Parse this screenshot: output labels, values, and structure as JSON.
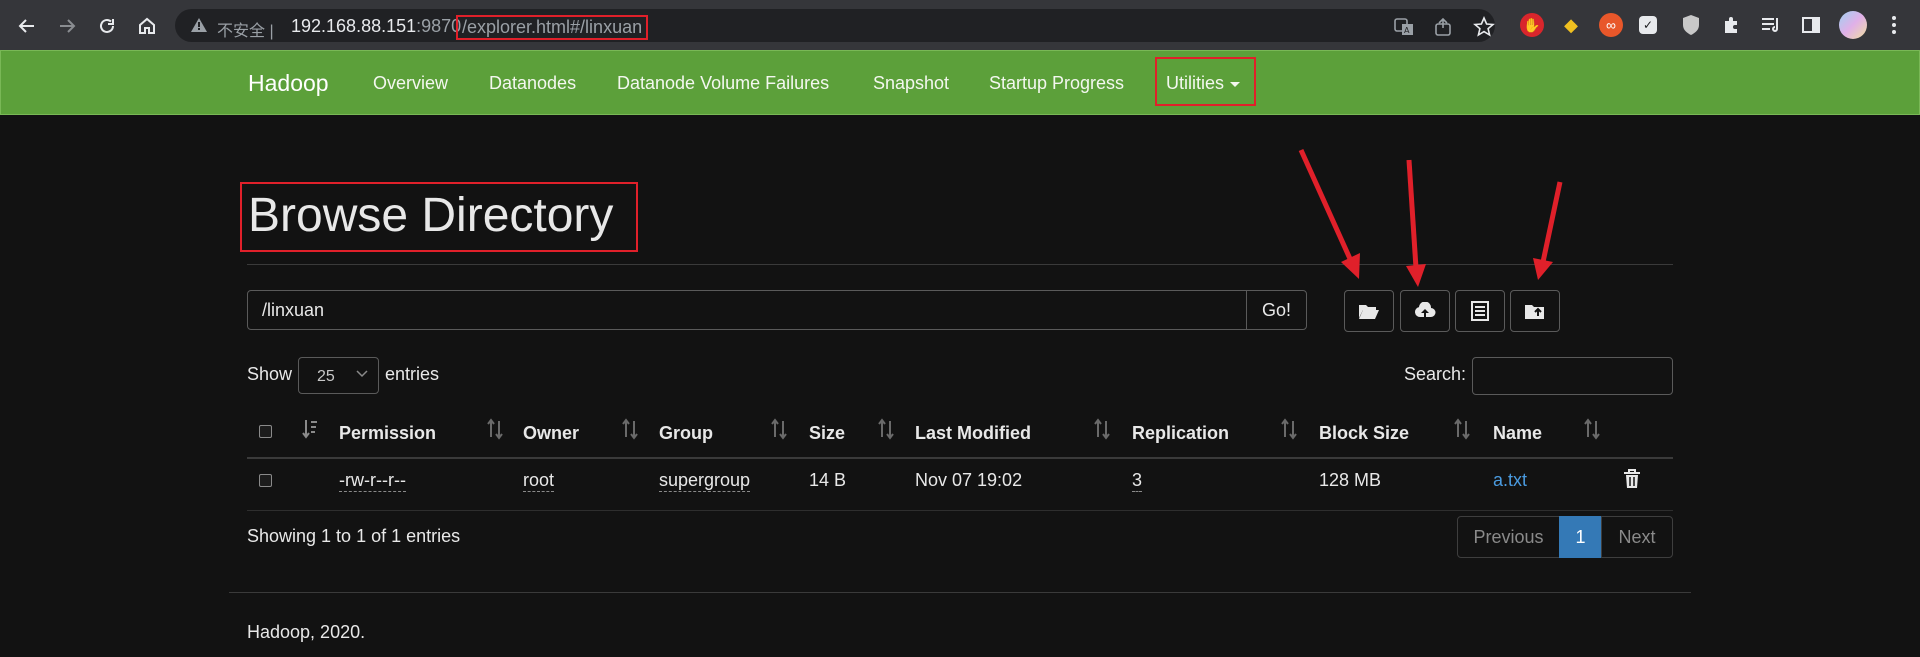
{
  "browser": {
    "security_label": "不安全",
    "separator": "|",
    "host": "192.168.88.151",
    "port": ":9870",
    "path": "/explorer.html#/linxuan"
  },
  "navbar": {
    "brand": "Hadoop",
    "links": [
      "Overview",
      "Datanodes",
      "Datanode Volume Failures",
      "Snapshot",
      "Startup Progress",
      "Utilities"
    ]
  },
  "page": {
    "title": "Browse Directory",
    "path_value": "/linxuan",
    "go_label": "Go!"
  },
  "table_controls": {
    "show_label": "Show",
    "entries_value": "25",
    "entries_label": "entries",
    "search_label": "Search:"
  },
  "table": {
    "columns": [
      "Permission",
      "Owner",
      "Group",
      "Size",
      "Last Modified",
      "Replication",
      "Block Size",
      "Name"
    ],
    "rows": [
      {
        "permission": "-rw-r--r--",
        "owner": "root",
        "group": "supergroup",
        "size": "14 B",
        "last_modified": "Nov 07 19:02",
        "replication": "3",
        "block_size": "128 MB",
        "name": "a.txt"
      }
    ]
  },
  "pagination": {
    "info": "Showing 1 to 1 of 1 entries",
    "previous": "Previous",
    "current": "1",
    "next": "Next"
  },
  "footer": {
    "text": "Hadoop, 2020."
  },
  "colors": {
    "navbar": "#5ca03a",
    "accent": "#3479b6",
    "annotation": "#e0202a",
    "link": "#4a9be0"
  }
}
